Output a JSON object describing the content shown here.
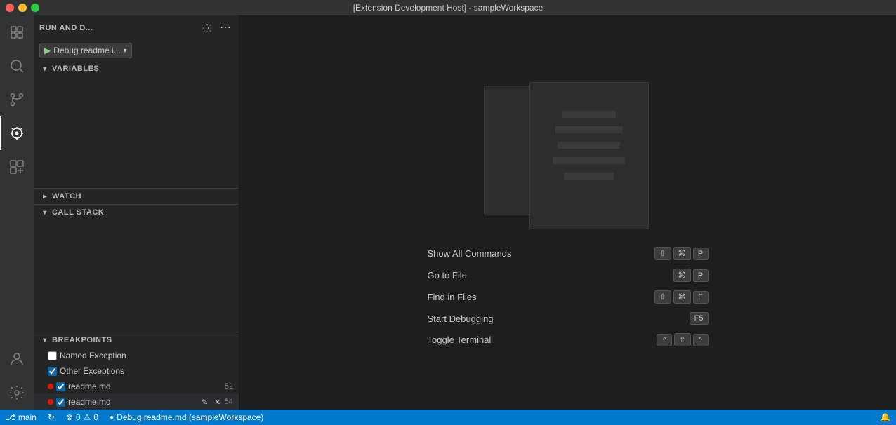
{
  "titleBar": {
    "title": "[Extension Development Host] - sampleWorkspace"
  },
  "sidebar": {
    "runAndDebugTitle": "RUN AND D...",
    "debugConfig": "Debug readme.i...",
    "sections": {
      "variables": "VARIABLES",
      "watch": "WATCH",
      "callStack": "CALL STACK",
      "breakpoints": "BREAKPOINTS"
    },
    "breakpoints": [
      {
        "id": "named-exception",
        "label": "Named Exception",
        "checked": false,
        "hasDot": false
      },
      {
        "id": "other-exceptions",
        "label": "Other Exceptions",
        "checked": true,
        "hasDot": false
      },
      {
        "id": "readme-md-1",
        "label": "readme.md",
        "checked": true,
        "hasDot": true,
        "lineNum": "52"
      },
      {
        "id": "readme-md-2",
        "label": "readme.md",
        "checked": true,
        "hasDot": true,
        "lineNum": "54"
      }
    ]
  },
  "commands": [
    {
      "label": "Show All Commands",
      "keys": [
        "⇧",
        "⌘",
        "P"
      ]
    },
    {
      "label": "Go to File",
      "keys": [
        "⌘",
        "P"
      ]
    },
    {
      "label": "Find in Files",
      "keys": [
        "⇧",
        "⌘",
        "F"
      ]
    },
    {
      "label": "Start Debugging",
      "keys": [
        "F5"
      ]
    },
    {
      "label": "Toggle Terminal",
      "keys": [
        "^",
        "⇧",
        "^"
      ]
    }
  ],
  "statusBar": {
    "branch": "main",
    "syncIcon": "↻",
    "errors": "0",
    "warnings": "0",
    "debugLabel": "Debug readme.md (sampleWorkspace)",
    "bellIcon": "🔔"
  },
  "docLines": [
    {
      "width": "60%"
    },
    {
      "width": "75%"
    },
    {
      "width": "70%"
    },
    {
      "width": "80%"
    },
    {
      "width": "55%"
    }
  ]
}
